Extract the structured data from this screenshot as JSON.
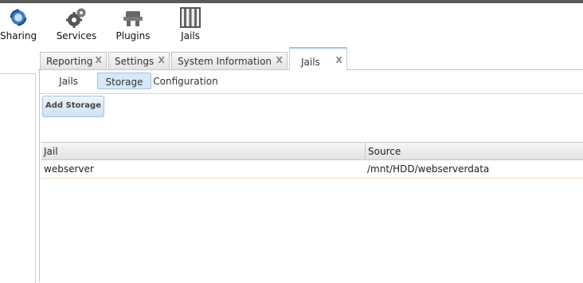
{
  "toolbar": {
    "items": [
      {
        "label": "Sharing",
        "icon": "sharing-icon"
      },
      {
        "label": "Services",
        "icon": "gears-icon"
      },
      {
        "label": "Plugins",
        "icon": "plugins-icon"
      },
      {
        "label": "Jails",
        "icon": "jail-bars-icon"
      }
    ]
  },
  "tabs": [
    {
      "label": "Reporting",
      "close": "X"
    },
    {
      "label": "Settings",
      "close": "X"
    },
    {
      "label": "System Information",
      "close": "X"
    },
    {
      "label": "Jails",
      "close": "X",
      "active": true
    }
  ],
  "subtabs": [
    {
      "label": "Jails"
    },
    {
      "label": "Storage",
      "active": true
    },
    {
      "label": "Configuration"
    }
  ],
  "add_button": "Add Storage",
  "table": {
    "columns": [
      "Jail",
      "Source"
    ],
    "rows": [
      [
        "webserver",
        "/mnt/HDD/webserverdata"
      ]
    ]
  },
  "colors": {
    "active_blue": "#d7e8f8",
    "border_blue": "#9ec4e8"
  }
}
